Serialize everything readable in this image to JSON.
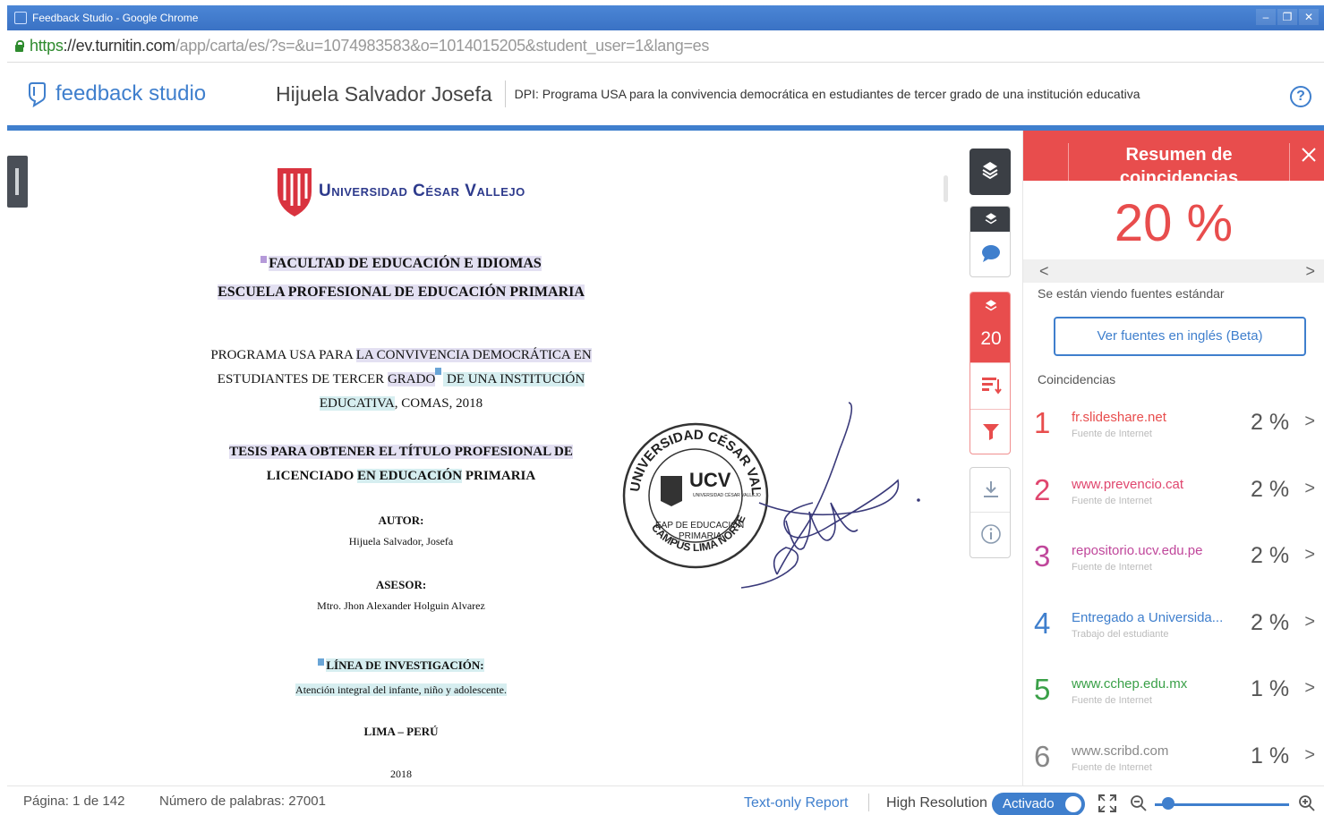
{
  "window": {
    "title": "Feedback Studio - Google Chrome",
    "url_scheme": "https",
    "url_host": "://ev.turnitin.com",
    "url_path": "/app/carta/es/?s=&u=1074983583&o=1014015205&student_user=1&lang=es"
  },
  "header": {
    "brand": "feedback studio",
    "student_name": "Hijuela Salvador Josefa",
    "assignment": "DPI: Programa USA para la convivencia democrática en estudiantes de tercer grado de una institución educativa",
    "help_label": "?"
  },
  "document": {
    "university": "Universidad César Vallejo",
    "faculty": "FACULTAD DE EDUCACIÓN E IDIOMAS",
    "school": "ESCUELA PROFESIONAL DE EDUCACIÓN PRIMARIA",
    "program_line1_a": "PROGRAMA USA PARA ",
    "program_line1_b": "LA CONVIVENCIA DEMOCRÁTICA EN",
    "program_line2_a": "ESTUDIANTES DE TERCER ",
    "program_line2_b": "GRADO",
    "program_line2_c": " DE UNA INSTITUCIÓN",
    "program_line3_a": "EDUCATIVA",
    "program_line3_b": ", COMAS, 2018",
    "tesis_line1": "TESIS PARA OBTENER EL TÍTULO PROFESIONAL DE",
    "tesis_line2_a": "LICENCIADO ",
    "tesis_line2_b": "EN EDUCACIÓN",
    "tesis_line2_c": " PRIMARIA",
    "autor_label": "AUTOR:",
    "autor": "Hijuela Salvador, Josefa",
    "asesor_label": "ASESOR:",
    "asesor": "Mtro. Jhon Alexander Holguin Alvarez",
    "linea_label": "LÍNEA DE INVESTIGACIÓN:",
    "linea": "Atención integral del infante, niño y adolescente.",
    "lugar": "LIMA – PERÚ",
    "year": "2018",
    "stamp_top": "UNIVERSIDAD CÉSAR VALLEJO",
    "stamp_bottom": "CAMPUS LIMA NORTE",
    "stamp_ucv": "UCV",
    "stamp_small": "UNIVERSIDAD CÉSAR VALLEJO",
    "stamp_eap": "EAP DE EDUCACIÓN",
    "stamp_primaria": "PRIMARIA"
  },
  "toolbar": {
    "score": "20"
  },
  "panel": {
    "title": "Resumen de coincidencias",
    "percent": "20 %",
    "viewing": "Se están viendo fuentes estándar",
    "english_button": "Ver fuentes en inglés (Beta)",
    "matches_label": "Coincidencias",
    "matches": [
      {
        "n": "1",
        "source": "fr.slideshare.net",
        "type": "Fuente de Internet",
        "pct": "2 %",
        "color": "#e84d4d"
      },
      {
        "n": "2",
        "source": "www.prevencio.cat",
        "type": "Fuente de Internet",
        "pct": "2 %",
        "color": "#e0466e"
      },
      {
        "n": "3",
        "source": "repositorio.ucv.edu.pe",
        "type": "Fuente de Internet",
        "pct": "2 %",
        "color": "#c0479b"
      },
      {
        "n": "4",
        "source": "Entregado a Universida...",
        "type": "Trabajo del estudiante",
        "pct": "2 %",
        "color": "#3f7fcd"
      },
      {
        "n": "5",
        "source": "www.cchep.edu.mx",
        "type": "Fuente de Internet",
        "pct": "1 %",
        "color": "#3aa048"
      },
      {
        "n": "6",
        "source": "www.scribd.com",
        "type": "Fuente de Internet",
        "pct": "1 %",
        "color": "#888888"
      }
    ]
  },
  "status": {
    "page": "Página: 1 de 142",
    "words": "Número de palabras: 27001",
    "text_only": "Text-only Report",
    "high_res": "High Resolution",
    "toggle": "Activado",
    "zoom_level": 0.1
  },
  "colors": {
    "accent": "#3f7fcd",
    "similarity": "#e84d4d"
  }
}
